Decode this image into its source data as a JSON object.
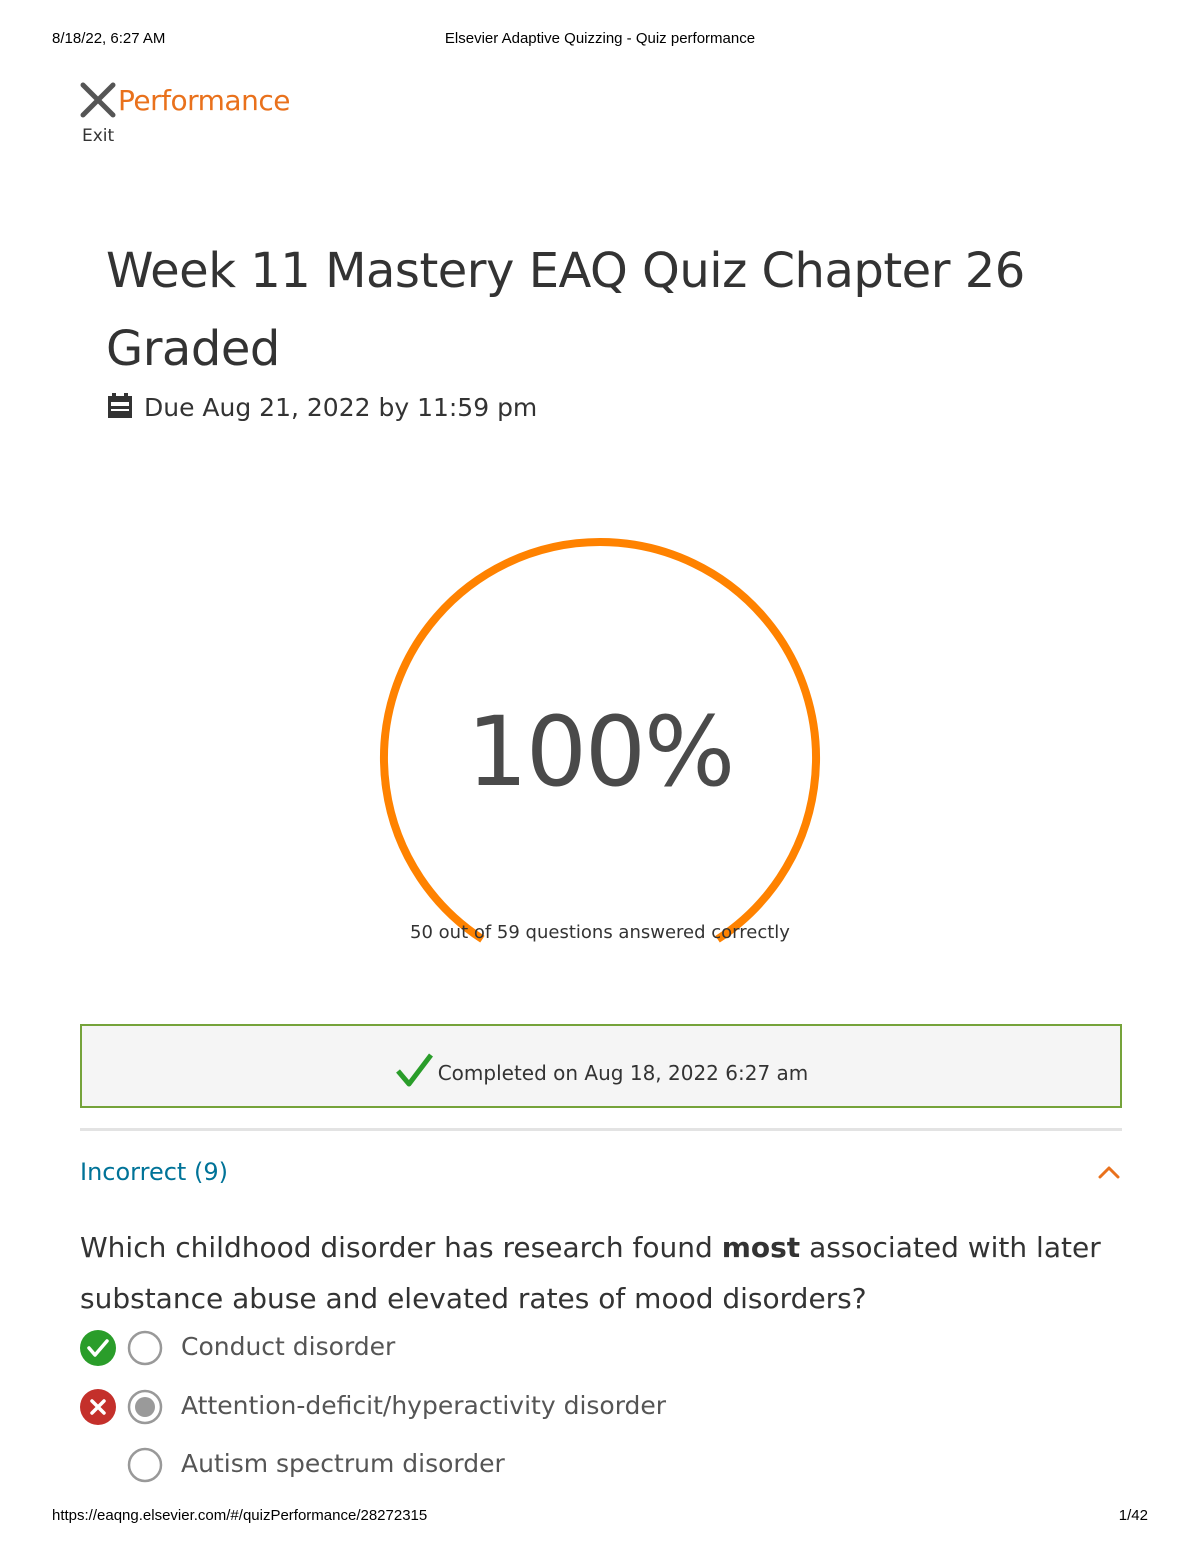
{
  "print_header": {
    "datetime": "8/18/22, 6:27 AM",
    "page_title": "Elsevier Adaptive Quizzing - Quiz performance"
  },
  "print_footer": {
    "url": "https://eaqng.elsevier.com/#/quizPerformance/28272315",
    "page_number": "1/42"
  },
  "topbar": {
    "close_icon": "close-x-icon",
    "title": "Performance",
    "exit_label": "Exit"
  },
  "quiz": {
    "title_line1": "Week 11 Mastery EAQ Quiz Chapter 26",
    "title_line2": "Graded",
    "due_icon": "calendar-icon",
    "due_text": "Due Aug 21, 2022 by 11:59 pm"
  },
  "score": {
    "percent_text": "100%",
    "percent_value": 100,
    "summary": "50 out of 59 questions answered correctly",
    "gauge_color": "#ff8200"
  },
  "completion": {
    "icon": "checkmark-icon",
    "text": "Completed on Aug 18, 2022 6:27 am",
    "border_color": "#75a33a"
  },
  "incorrect_section": {
    "label": "Incorrect (9)",
    "expanded": true,
    "chevron_icon": "chevron-up-icon",
    "question": {
      "text_before": "Which childhood disorder has research found ",
      "text_bold": "most",
      "text_after": " associated with later substance abuse and elevated rates of mood disorders?",
      "options": [
        {
          "label": "Conduct disorder",
          "status": "correct",
          "selected": false
        },
        {
          "label": "Attention-deficit/hyperactivity disorder",
          "status": "incorrect",
          "selected": true
        },
        {
          "label": "Autism spectrum disorder",
          "status": "none",
          "selected": false
        }
      ]
    }
  },
  "colors": {
    "accent_orange": "#e9711c",
    "link_teal": "#007398",
    "correct_green": "#2a9d2a",
    "incorrect_red": "#c4302b"
  }
}
